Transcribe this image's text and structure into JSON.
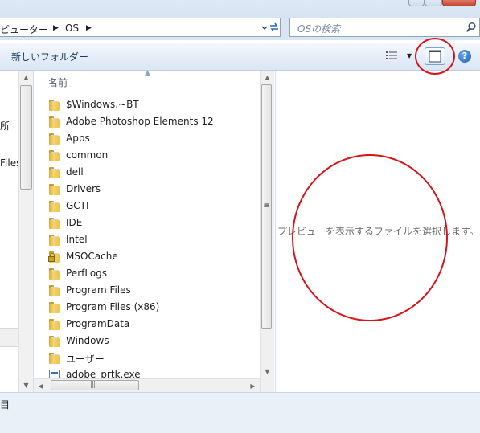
{
  "window": {
    "breadcrumb": [
      "ピューター",
      "OS"
    ],
    "search_placeholder": "OSの検索"
  },
  "toolbar": {
    "new_folder_label": "新しいフォルダー",
    "view_dropdown_glyph": "▼",
    "help_glyph": "?"
  },
  "nav_pane": {
    "items": [
      "所",
      "Files"
    ]
  },
  "file_list": {
    "column_name": "名前",
    "items": [
      {
        "name": "$Windows.~BT",
        "icon": "folder-icon"
      },
      {
        "name": "Adobe Photoshop Elements 12",
        "icon": "folder-icon"
      },
      {
        "name": "Apps",
        "icon": "folder-icon"
      },
      {
        "name": "common",
        "icon": "folder-icon"
      },
      {
        "name": "dell",
        "icon": "folder-icon"
      },
      {
        "name": "Drivers",
        "icon": "folder-icon"
      },
      {
        "name": "GCTI",
        "icon": "folder-icon"
      },
      {
        "name": "IDE",
        "icon": "folder-icon"
      },
      {
        "name": "Intel",
        "icon": "folder-icon"
      },
      {
        "name": "MSOCache",
        "icon": "locked-folder-icon"
      },
      {
        "name": "PerfLogs",
        "icon": "folder-icon"
      },
      {
        "name": "Program Files",
        "icon": "folder-icon"
      },
      {
        "name": "Program Files (x86)",
        "icon": "folder-icon"
      },
      {
        "name": "ProgramData",
        "icon": "folder-icon"
      },
      {
        "name": "Windows",
        "icon": "folder-icon"
      },
      {
        "name": "ユーザー",
        "icon": "folder-icon"
      },
      {
        "name": "adobe_prtk.exe",
        "icon": "exe-icon"
      }
    ]
  },
  "preview": {
    "message": "プレビューを表示するファイルを選択します。"
  },
  "details": {
    "label": "目"
  },
  "colors": {
    "annotation_red": "#d7141a",
    "toolbar_bg": "#e6eef8"
  }
}
